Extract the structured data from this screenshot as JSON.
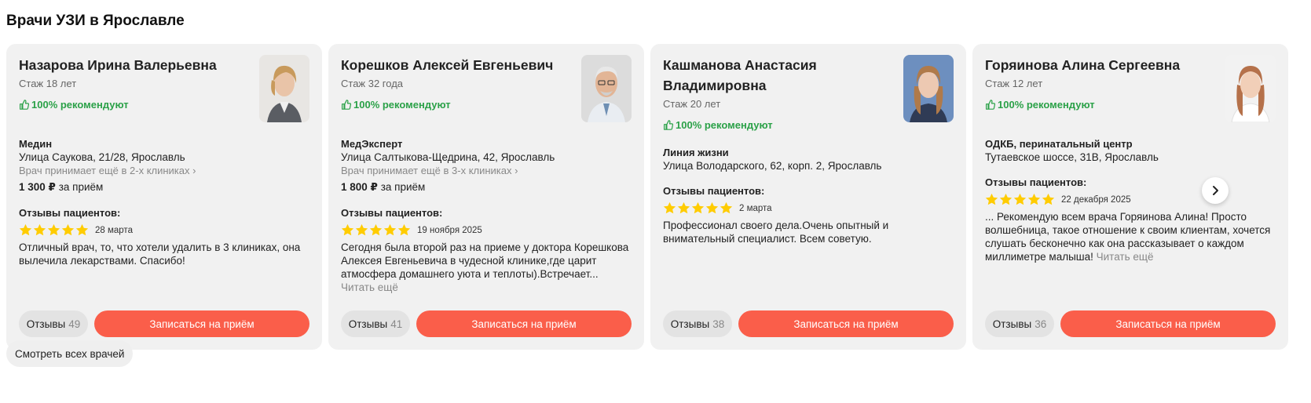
{
  "page": {
    "title": "Врачи УЗИ в Ярославле",
    "all_doctors_label": "Смотреть всех врачей"
  },
  "colors": {
    "accent": "#fa5e4a",
    "recommend": "#2ba148",
    "star": "#ffcc00",
    "card_bg": "#f1f1f1"
  },
  "icons": {
    "recommend": "thumb-up-icon",
    "star": "star-icon",
    "next": "chevron-right-icon",
    "more": "chevron-right-icon"
  },
  "common": {
    "reviews_title": "Отзывы пациентов:",
    "book_label": "Записаться на приём",
    "reviews_label": "Отзывы",
    "read_more": "Читать ещё",
    "rating_max": 5
  },
  "doctors": [
    {
      "name_line1": "Назарова Ирина Валерьевна",
      "name_line2": "",
      "experience": "Стаж 18 лет",
      "recommend": "100% рекомендуют",
      "clinic_name": "Медин",
      "clinic_address": "Улица Саукова, 21/28, Ярославль",
      "more_clinics": "Врач принимает ещё в 2-х клиниках",
      "price_value": "1 300 ₽",
      "price_suffix": " за приём",
      "rating": 5,
      "review_date": "28 марта",
      "review_text": "Отличный врач, то, что хотели удалить в 3 клиниках, она вылечила лекарствами. Спасибо!",
      "reviews_count": "49"
    },
    {
      "name_line1": "Корешков Алексей Евгеньевич",
      "name_line2": "",
      "experience": "Стаж 32 года",
      "recommend": "100% рекомендуют",
      "clinic_name": "МедЭксперт",
      "clinic_address": "Улица Салтыкова-Щедрина, 42, Ярославль",
      "more_clinics": "Врач принимает ещё в 3-х клиниках",
      "price_value": "1 800 ₽",
      "price_suffix": " за приём",
      "rating": 5,
      "review_date": "19 ноября 2025",
      "review_text": "Сегодня была второй раз на приеме у доктора Корешкова Алексея Евгеньевича в чудесной клинике,где царит атмосфера домашнего уюта и теплоты).Встречает...",
      "reviews_count": "41"
    },
    {
      "name_line1": "Кашманова Анастасия",
      "name_line2": "Владимировна",
      "experience": "Стаж 20 лет",
      "recommend": "100% рекомендуют",
      "clinic_name": "Линия жизни",
      "clinic_address": "Улица Володарского, 62, корп. 2, Ярославль",
      "rating": 5,
      "review_date": "2 марта",
      "review_text": "Профессионал своего дела.Очень опытный и внимательный специалист. Всем советую.",
      "reviews_count": "38"
    },
    {
      "name_line1": "Горяинова Алина Сергеевна",
      "name_line2": "",
      "experience": "Стаж 12 лет",
      "recommend": "100% рекомендуют",
      "clinic_name": "ОДКБ, перинатальный центр",
      "clinic_address": "Тутаевское шоссе, 31В, Ярославль",
      "rating": 5,
      "review_date": "22 декабря 2025",
      "review_text": "... Рекомендую всем врача Горяинова Алина! Просто волшебница, такое отношение к своим клиентам, хочется слушать бесконечно как она рассказывает о каждом миллиметре малыша!",
      "reviews_count": "36"
    }
  ]
}
